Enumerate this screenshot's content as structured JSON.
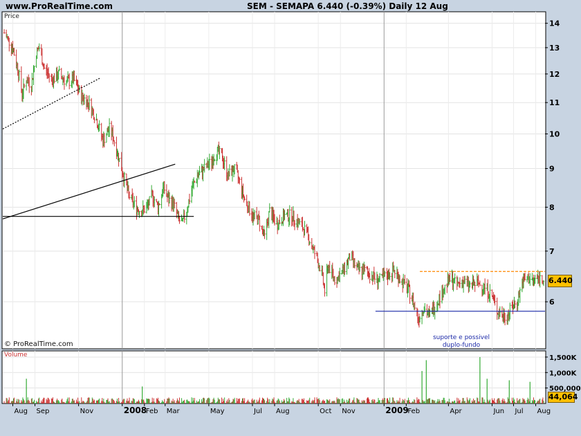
{
  "header": {
    "site": "www.ProRealTime.com",
    "title": "SEM - SEMAPA     6.440 (-0.39%)     Daily  12 Aug"
  },
  "panels": {
    "price_label": "Price",
    "volume_label": "Volume",
    "copyright": "© ProRealTime.com"
  },
  "annotation": {
    "line1": "suporte e possivel",
    "line2": "duplo-fundo"
  },
  "current": {
    "price": "6.440",
    "volume": "44,064"
  },
  "colors": {
    "up": "#33aa33",
    "down": "#cc3333",
    "support": "#1c2aa8",
    "resistance": "#ff8800",
    "price_box": "#ffc000",
    "background": "#c8d4e2",
    "plot": "#ffffff"
  },
  "chart_data": {
    "type": "line",
    "title": "SEM - SEMAPA",
    "symbol": "SEM",
    "period": "Daily",
    "last": 6.44,
    "change_pct": -0.39,
    "price_axis_ticks": [
      6,
      7,
      8,
      9,
      10,
      11,
      12,
      13,
      14
    ],
    "volume_axis_ticks": [
      "500,000",
      "1,000K",
      "1,500K"
    ],
    "x_labels": [
      "Aug",
      "Sep",
      "Nov",
      "2008",
      "Feb",
      "Mar",
      "May",
      "Jul",
      "Aug",
      "Oct",
      "Nov",
      "2009",
      "Feb",
      "Apr",
      "Jun",
      "Jul",
      "Aug"
    ],
    "x_label_dates": [
      "2007-08-01",
      "2007-09-01",
      "2007-11-01",
      "2008-01-01",
      "2008-02-01",
      "2008-03-01",
      "2008-05-01",
      "2008-07-01",
      "2008-08-01",
      "2008-10-01",
      "2008-11-01",
      "2009-01-01",
      "2009-02-01",
      "2009-04-01",
      "2009-06-01",
      "2009-07-01",
      "2009-08-01"
    ],
    "x_range": [
      "2007-07-18",
      "2009-08-14"
    ],
    "ylim": [
      5.2,
      14.5
    ],
    "log_scale": true,
    "volume_ylim": [
      0,
      1700000
    ],
    "series": [
      {
        "name": "SEM",
        "points": [
          [
            "2007-07-20",
            13.6
          ],
          [
            "2007-08-01",
            13.0
          ],
          [
            "2007-08-08",
            12.2
          ],
          [
            "2007-08-14",
            11.3
          ],
          [
            "2007-08-20",
            11.8
          ],
          [
            "2007-08-27",
            11.6
          ],
          [
            "2007-09-03",
            12.8
          ],
          [
            "2007-09-07",
            13.0
          ],
          [
            "2007-09-14",
            12.2
          ],
          [
            "2007-09-25",
            11.8
          ],
          [
            "2007-10-05",
            12.0
          ],
          [
            "2007-10-15",
            11.7
          ],
          [
            "2007-10-25",
            11.8
          ],
          [
            "2007-11-05",
            11.2
          ],
          [
            "2007-11-15",
            11.0
          ],
          [
            "2007-11-25",
            10.5
          ],
          [
            "2007-12-05",
            9.8
          ],
          [
            "2007-12-15",
            10.2
          ],
          [
            "2007-12-22",
            9.7
          ],
          [
            "2007-12-31",
            9.0
          ],
          [
            "2008-01-10",
            8.3
          ],
          [
            "2008-01-20",
            8.0
          ],
          [
            "2008-01-28",
            7.9
          ],
          [
            "2008-02-05",
            8.0
          ],
          [
            "2008-02-12",
            8.3
          ],
          [
            "2008-02-20",
            8.0
          ],
          [
            "2008-02-28",
            8.5
          ],
          [
            "2008-03-05",
            8.2
          ],
          [
            "2008-03-12",
            8.1
          ],
          [
            "2008-03-20",
            7.7
          ],
          [
            "2008-03-25",
            7.6
          ],
          [
            "2008-04-01",
            8.0
          ],
          [
            "2008-04-08",
            8.5
          ],
          [
            "2008-04-15",
            8.8
          ],
          [
            "2008-04-25",
            9.0
          ],
          [
            "2008-05-05",
            9.2
          ],
          [
            "2008-05-12",
            9.5
          ],
          [
            "2008-05-20",
            9.3
          ],
          [
            "2008-05-28",
            8.8
          ],
          [
            "2008-06-05",
            9.0
          ],
          [
            "2008-06-12",
            8.7
          ],
          [
            "2008-06-20",
            8.2
          ],
          [
            "2008-07-01",
            7.8
          ],
          [
            "2008-07-10",
            7.7
          ],
          [
            "2008-07-18",
            7.3
          ],
          [
            "2008-07-25",
            7.9
          ],
          [
            "2008-08-04",
            7.6
          ],
          [
            "2008-08-15",
            7.8
          ],
          [
            "2008-08-25",
            7.8
          ],
          [
            "2008-09-05",
            7.6
          ],
          [
            "2008-09-15",
            7.4
          ],
          [
            "2008-09-25",
            7.0
          ],
          [
            "2008-10-05",
            6.6
          ],
          [
            "2008-10-10",
            6.2
          ],
          [
            "2008-10-15",
            6.7
          ],
          [
            "2008-10-25",
            6.4
          ],
          [
            "2008-11-05",
            6.6
          ],
          [
            "2008-11-15",
            6.9
          ],
          [
            "2008-11-25",
            6.6
          ],
          [
            "2008-12-05",
            6.6
          ],
          [
            "2008-12-15",
            6.5
          ],
          [
            "2008-12-25",
            6.4
          ],
          [
            "2009-01-05",
            6.5
          ],
          [
            "2009-01-15",
            6.6
          ],
          [
            "2009-01-25",
            6.4
          ],
          [
            "2009-02-05",
            6.2
          ],
          [
            "2009-02-12",
            5.95
          ],
          [
            "2009-02-18",
            5.7
          ],
          [
            "2009-02-25",
            5.9
          ],
          [
            "2009-03-05",
            5.75
          ],
          [
            "2009-03-12",
            5.9
          ],
          [
            "2009-03-20",
            6.1
          ],
          [
            "2009-03-28",
            6.3
          ],
          [
            "2009-04-05",
            6.45
          ],
          [
            "2009-04-12",
            6.3
          ],
          [
            "2009-04-20",
            6.4
          ],
          [
            "2009-05-01",
            6.3
          ],
          [
            "2009-05-10",
            6.35
          ],
          [
            "2009-05-20",
            6.3
          ],
          [
            "2009-06-01",
            6.1
          ],
          [
            "2009-06-08",
            5.85
          ],
          [
            "2009-06-15",
            5.75
          ],
          [
            "2009-06-22",
            5.75
          ],
          [
            "2009-06-29",
            5.9
          ],
          [
            "2009-07-06",
            6.0
          ],
          [
            "2009-07-13",
            6.35
          ],
          [
            "2009-07-20",
            6.45
          ],
          [
            "2009-07-28",
            6.4
          ],
          [
            "2009-08-05",
            6.45
          ],
          [
            "2009-08-12",
            6.44
          ]
        ]
      }
    ],
    "volume_spikes": [
      [
        "2007-08-20",
        800000
      ],
      [
        "2008-01-29",
        550000
      ],
      [
        "2009-02-23",
        1050000
      ],
      [
        "2009-03-01",
        1400000
      ],
      [
        "2009-05-15",
        1500000
      ],
      [
        "2009-05-25",
        800000
      ],
      [
        "2009-06-25",
        750000
      ],
      [
        "2009-07-24",
        700000
      ]
    ],
    "trendlines": [
      {
        "style": "dotted",
        "color": "#000000",
        "from": [
          "2007-07-18",
          10.15
        ],
        "to": [
          "2007-12-01",
          11.85
        ]
      },
      {
        "style": "solid",
        "color": "#000000",
        "from": [
          "2007-07-18",
          7.72
        ],
        "to": [
          "2008-03-15",
          9.12
        ]
      },
      {
        "style": "solid",
        "color": "#000000",
        "from": [
          "2007-07-18",
          7.78
        ],
        "to": [
          "2008-04-10",
          7.78
        ]
      },
      {
        "style": "dashed",
        "color": "#ff8800",
        "from": [
          "2009-02-20",
          6.58
        ],
        "to": [
          "2009-08-14",
          6.58
        ]
      },
      {
        "style": "solid",
        "color": "#1c2aa8",
        "from": [
          "2008-12-20",
          5.83
        ],
        "to": [
          "2009-08-14",
          5.83
        ]
      }
    ]
  }
}
